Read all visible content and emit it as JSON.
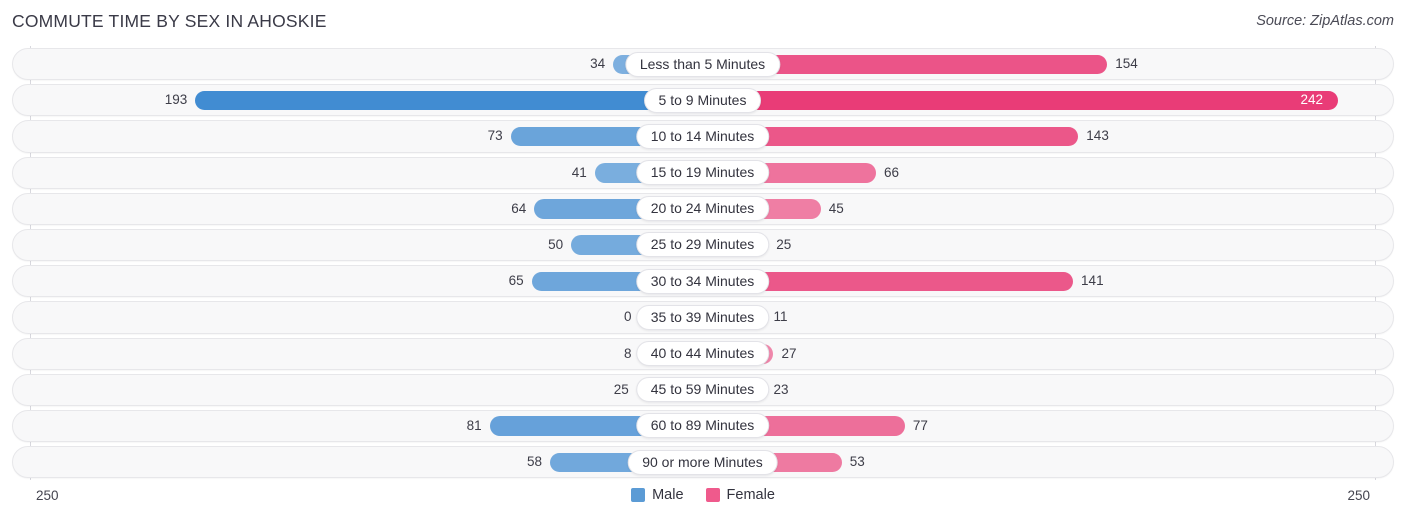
{
  "header": {
    "title": "COMMUTE TIME BY SEX IN AHOSKIE",
    "source": "Source: ZipAtlas.com"
  },
  "legend": {
    "male_label": "Male",
    "female_label": "Female",
    "male_color": "#5b9bd5",
    "female_color": "#ef5a8c"
  },
  "axis": {
    "left_tick": "250",
    "right_tick": "250"
  },
  "chart_data": {
    "type": "bar",
    "subtype": "diverging-horizontal-bar",
    "title": "COMMUTE TIME BY SEX IN AHOSKIE",
    "xlabel": "",
    "ylabel": "",
    "grid": false,
    "legend_position": "bottom-center",
    "axis_max": 250,
    "axis_min": 0,
    "left_axis_tick_labels": [
      "250"
    ],
    "right_axis_tick_labels": [
      "250"
    ],
    "categories": [
      "Less than 5 Minutes",
      "5 to 9 Minutes",
      "10 to 14 Minutes",
      "15 to 19 Minutes",
      "20 to 24 Minutes",
      "25 to 29 Minutes",
      "30 to 34 Minutes",
      "35 to 39 Minutes",
      "40 to 44 Minutes",
      "45 to 59 Minutes",
      "60 to 89 Minutes",
      "90 or more Minutes"
    ],
    "series": [
      {
        "name": "Male",
        "color": "#5b9bd5",
        "direction": "left",
        "values": [
          34,
          193,
          73,
          41,
          64,
          50,
          65,
          0,
          8,
          25,
          81,
          58
        ]
      },
      {
        "name": "Female",
        "color": "#ef5a8c",
        "direction": "right",
        "values": [
          154,
          242,
          143,
          66,
          45,
          25,
          141,
          11,
          27,
          23,
          77,
          53
        ]
      }
    ]
  },
  "rows": [
    {
      "label": "Less than 5 Minutes",
      "male": 34,
      "female": 154,
      "male_text": "34",
      "female_text": "154"
    },
    {
      "label": "5 to 9 Minutes",
      "male": 193,
      "female": 242,
      "male_text": "193",
      "female_text": "242"
    },
    {
      "label": "10 to 14 Minutes",
      "male": 73,
      "female": 143,
      "male_text": "73",
      "female_text": "143"
    },
    {
      "label": "15 to 19 Minutes",
      "male": 41,
      "female": 66,
      "male_text": "41",
      "female_text": "66"
    },
    {
      "label": "20 to 24 Minutes",
      "male": 64,
      "female": 45,
      "male_text": "64",
      "female_text": "45"
    },
    {
      "label": "25 to 29 Minutes",
      "male": 50,
      "female": 25,
      "male_text": "50",
      "female_text": "25"
    },
    {
      "label": "30 to 34 Minutes",
      "male": 65,
      "female": 141,
      "male_text": "65",
      "female_text": "141"
    },
    {
      "label": "35 to 39 Minutes",
      "male": 0,
      "female": 11,
      "male_text": "0",
      "female_text": "11"
    },
    {
      "label": "40 to 44 Minutes",
      "male": 8,
      "female": 27,
      "male_text": "8",
      "female_text": "27"
    },
    {
      "label": "45 to 59 Minutes",
      "male": 25,
      "female": 23,
      "male_text": "25",
      "female_text": "23"
    },
    {
      "label": "60 to 89 Minutes",
      "male": 81,
      "female": 77,
      "male_text": "81",
      "female_text": "77"
    },
    {
      "label": "90 or more Minutes",
      "male": 58,
      "female": 53,
      "male_text": "58",
      "female_text": "53"
    }
  ]
}
